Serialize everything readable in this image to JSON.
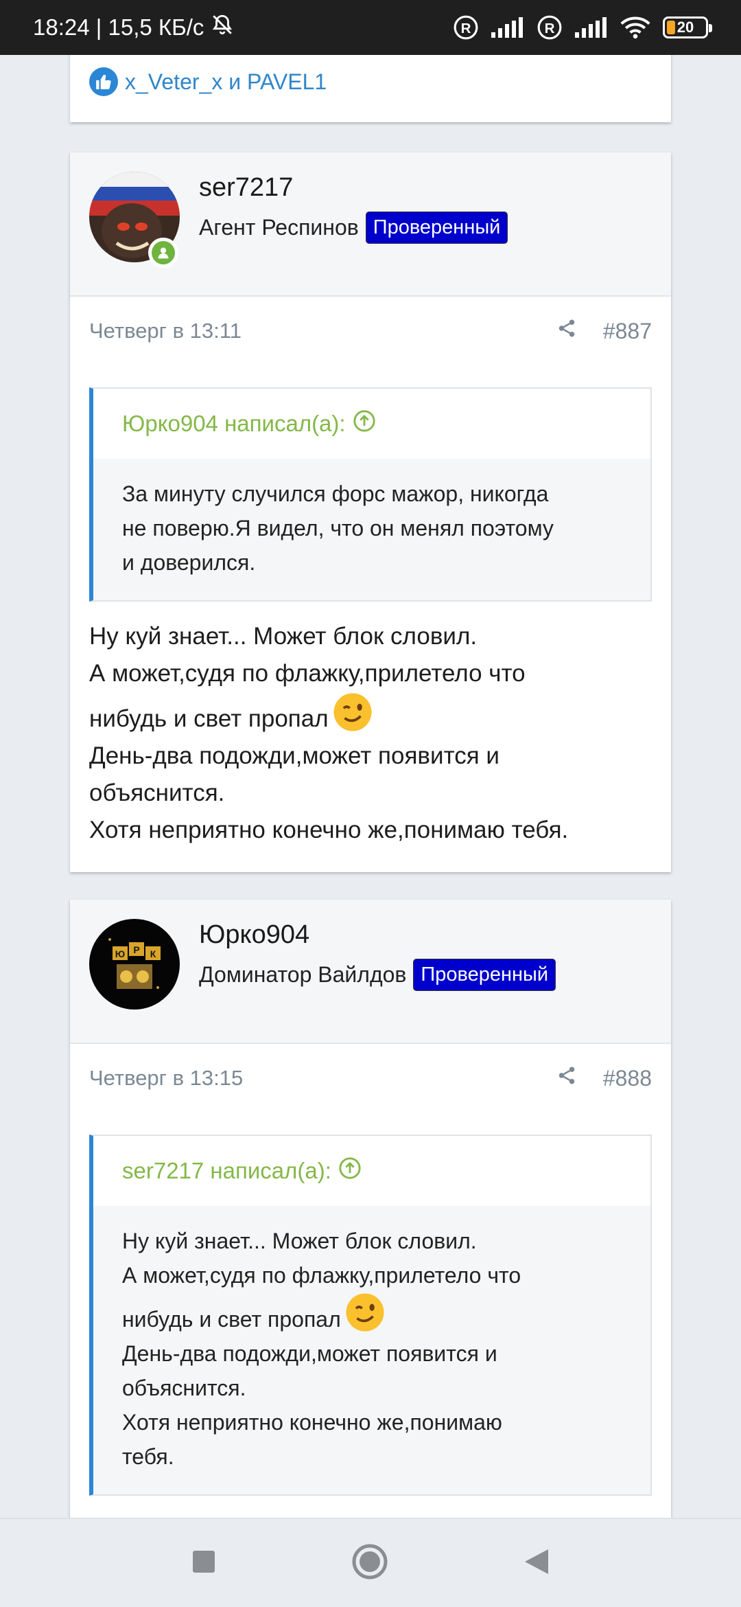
{
  "status_bar": {
    "time_speed": "18:24 | 15,5 КБ/с",
    "battery": "20",
    "icons": [
      "mute-bell-icon",
      "registered-icon",
      "signal-icon",
      "wifi-icon",
      "battery-icon"
    ]
  },
  "likes": {
    "text": "x_Veter_x и PAVEL1"
  },
  "posts": [
    {
      "username": "ser7217",
      "user_title": "Агент Респинов",
      "badge": "Проверенный",
      "date": "Четверг в 13:11",
      "number": "#887",
      "quote_author": "Юрко904 написал(а):",
      "quote_lines": [
        "За минуту случился форс мажор, никогда",
        "не поверю.Я видел, что он менял поэтому",
        "и доверился."
      ],
      "body_lines": [
        "Ну куй знает... Может блок словил.",
        "А может,судя по флажку,прилетело что",
        "нибудь и свет пропал",
        "День-два подожди,может появится и",
        "объяснится.",
        "Хотя неприятно конечно же,понимаю тебя."
      ]
    },
    {
      "username": "Юрко904",
      "user_title": "Доминатор Вайлдов",
      "badge": "Проверенный",
      "date": "Четверг в 13:15",
      "number": "#888",
      "quote_author": "ser7217 написал(а):",
      "quote_lines": [
        "Ну куй знает... Может блок словил.",
        "А может,судя по флажку,прилетело что",
        "нибудь и свет пропал",
        "День-два подожди,может появится и",
        "объяснится.",
        "Хотя неприятно конечно же,понимаю",
        "тебя."
      ]
    }
  ],
  "colors": {
    "accent_blue": "#2b86d6",
    "badge_blue": "#0000cc",
    "quote_green": "#84b848",
    "online_green": "#6eb43f"
  }
}
